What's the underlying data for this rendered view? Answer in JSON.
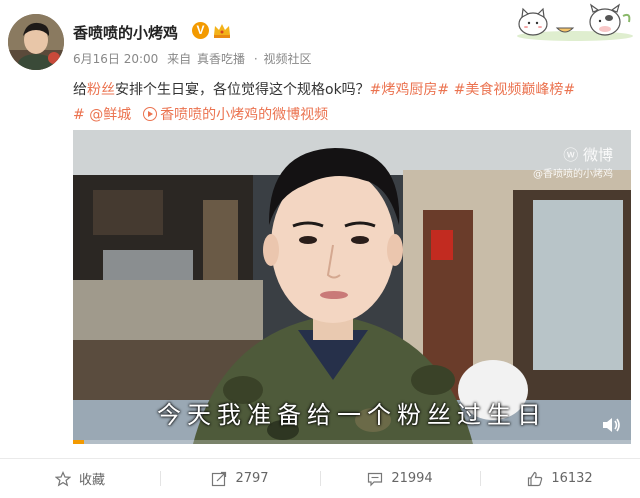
{
  "post": {
    "author": "香喷喷的小烤鸡",
    "date": "6月16日 20:00",
    "source_prefix": "来自",
    "source": "真香吃播",
    "source_sep": "·",
    "channel": "视频社区",
    "text_part1": "给",
    "text_highlight": "粉丝",
    "text_part2": "安排个生日宴，各位觉得这个规格ok吗？",
    "tags": [
      "#烤鸡厨房#",
      "#美食视频巅峰榜#"
    ],
    "mention": "@鲜城",
    "video_link": "香喷喷的小烤鸡的微博视频"
  },
  "video": {
    "watermark_brand": "微博",
    "watermark_user": "@香喷喷的小烤鸡",
    "subtitle": "今天我准备给一个粉丝过生日",
    "progress": 0.02
  },
  "actions": {
    "favorite": "收藏",
    "repost_count": "2797",
    "comment_count": "21994",
    "like_count": "16132"
  },
  "colors": {
    "accent": "#eb7350",
    "badge": "#f39a00",
    "muted": "#888888"
  },
  "icons": {
    "verified": "V",
    "crown": "crown-icon",
    "favorite": "star-icon",
    "repost": "repost-icon",
    "comment": "comment-icon",
    "like": "like-icon",
    "volume": "volume-icon"
  }
}
